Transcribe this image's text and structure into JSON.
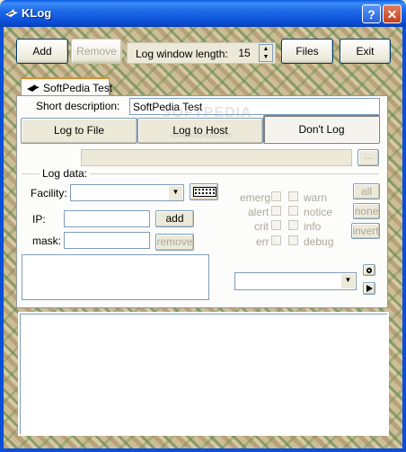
{
  "window": {
    "title": "KLog",
    "help_glyph": "?",
    "close_glyph": "✕",
    "icon": "klog-icon"
  },
  "toolbar": {
    "add_label": "Add",
    "remove_label": "Remove",
    "log_window_length_label": "Log window length:",
    "log_window_length_value": "15",
    "files_label": "Files",
    "exit_label": "Exit"
  },
  "tabs": [
    {
      "label": "SoftPedia Test",
      "icon": "bird-icon"
    }
  ],
  "config": {
    "short_description_label": "Short description:",
    "short_description_value": "SoftPedia Test",
    "log_to_file_label": "Log to File",
    "log_to_host_label": "Log to Host",
    "dont_log_label": "Don't Log",
    "browse_label": "...",
    "log_data_label": "Log data:",
    "facility_label": "Facility:",
    "facility_value": "",
    "ip_label": "IP:",
    "add_ip_label": "add",
    "mask_label": "mask:",
    "remove_ip_label": "remove",
    "levels_left": [
      "emerg",
      "alert",
      "crit",
      "err"
    ],
    "levels_right": [
      "warn",
      "notice",
      "info",
      "debug"
    ],
    "all_label": "all",
    "none_label": "none",
    "invert_label": "invert"
  },
  "watermark": "SOFTPEDIA",
  "watermark_url": "www.softpedia.com",
  "colors": {
    "titlebar": "#0a4fd6",
    "tab_accent": "#e68b2c",
    "face": "#ece9d8"
  }
}
